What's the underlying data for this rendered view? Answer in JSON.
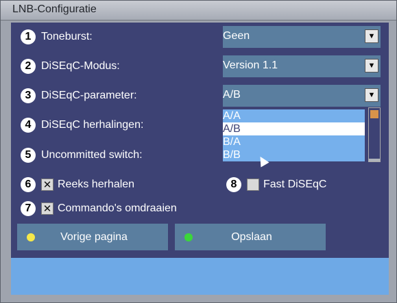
{
  "window": {
    "title": "LNB-Configuratie"
  },
  "settings": [
    {
      "num": "1",
      "label": "Toneburst:",
      "value": "Geen"
    },
    {
      "num": "2",
      "label": "DiSEqC-Modus:",
      "value": "Version 1.1"
    },
    {
      "num": "3",
      "label": "DiSEqC-parameter:",
      "value": "A/B"
    },
    {
      "num": "4",
      "label": "DiSEqC herhalingen:"
    },
    {
      "num": "5",
      "label": "Uncommitted switch:"
    }
  ],
  "dropdown_options": [
    "A/A",
    "A/B",
    "B/A",
    "B/B"
  ],
  "dropdown_selected": "A/B",
  "checkboxes": [
    {
      "num": "6",
      "label": "Reeks herhalen",
      "checked": true
    },
    {
      "num": "7",
      "label": "Commando's omdraaien",
      "checked": true
    },
    {
      "num": "8",
      "label": "Fast DiSEqC",
      "checked": false
    }
  ],
  "buttons": [
    {
      "label": "Vorige pagina",
      "dot_color": "#f5e84a"
    },
    {
      "label": "Opslaan",
      "dot_color": "#3bd63b"
    }
  ],
  "colors": {
    "panel": "#3d4274",
    "accent": "#6ea9e6",
    "control": "#5a7e9f"
  }
}
